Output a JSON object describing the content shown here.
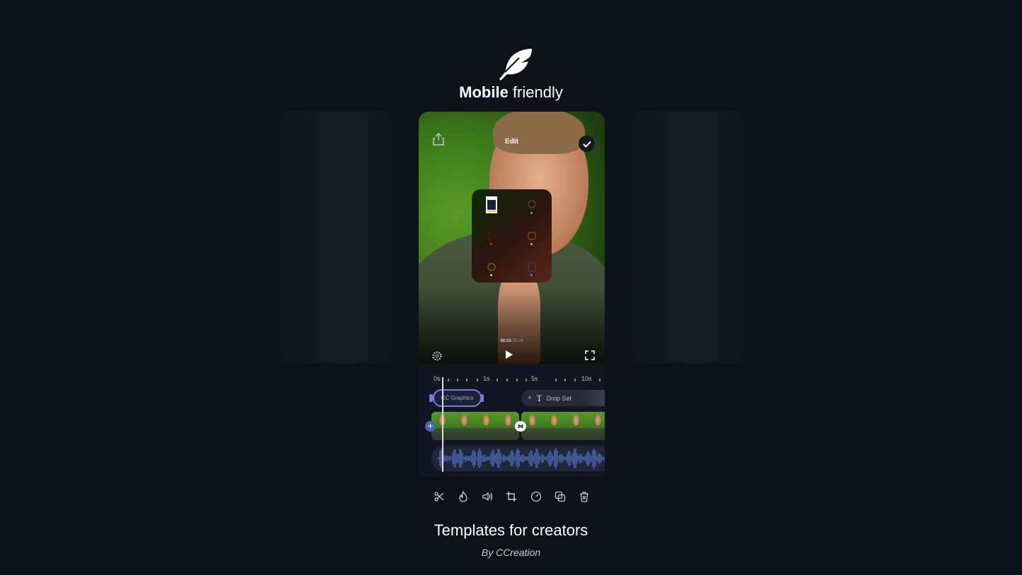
{
  "header": {
    "logo_icon": "feather-icon",
    "title_bold": "Mobile",
    "title_rest": "friendly"
  },
  "phone": {
    "video": {
      "title": "Edit",
      "current_time": "00:15",
      "total_time": "01:24",
      "icons": [
        "share-icon",
        "check-icon",
        "settings-icon",
        "play-icon",
        "fullscreen-icon"
      ],
      "panel_icons": [
        "template-thumbnail",
        "location-icon",
        "play-icon",
        "effects-icon",
        "refresh-icon",
        "card-icon"
      ]
    },
    "ruler": [
      "0s",
      "1s",
      "5s",
      "10s"
    ],
    "tracks": {
      "graphics_clip": "CC Graphics",
      "text_clip": "Drop Set"
    },
    "toolbar": [
      "scissors-icon",
      "flame-icon",
      "volume-icon",
      "crop-icon",
      "speed-icon",
      "duplicate-icon",
      "trash-icon"
    ]
  },
  "footer": {
    "title": "Templates for creators",
    "subtitle": "By CCreation"
  },
  "colors": {
    "background": "#0d111a",
    "accent": "#6b82e0"
  }
}
